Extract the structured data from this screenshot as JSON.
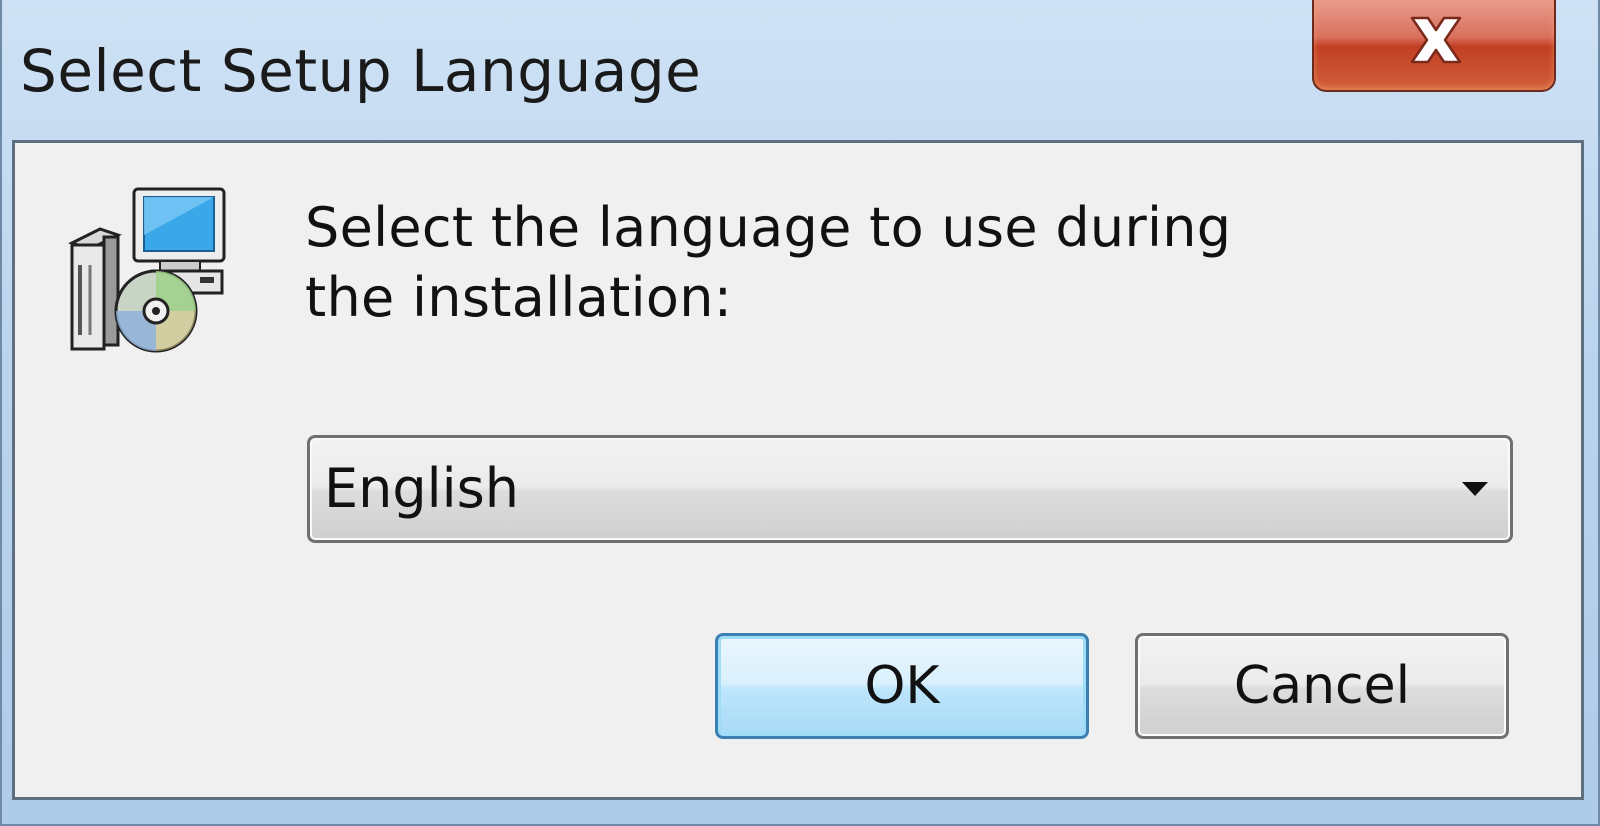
{
  "window": {
    "title": "Select Setup Language",
    "close_icon": "close-x-icon",
    "app_icon": "setup-installer-icon"
  },
  "dialog": {
    "prompt": "Select the language to use during the installation:",
    "language_select": {
      "selected": "English",
      "arrow_icon": "chevron-down-icon"
    },
    "buttons": {
      "ok_label": "OK",
      "cancel_label": "Cancel"
    }
  },
  "colors": {
    "titlebar": "#bcd5ee",
    "close_button": "#c23f24",
    "client_background": "#f0f0f0",
    "default_button_border": "#3c7fb1"
  }
}
